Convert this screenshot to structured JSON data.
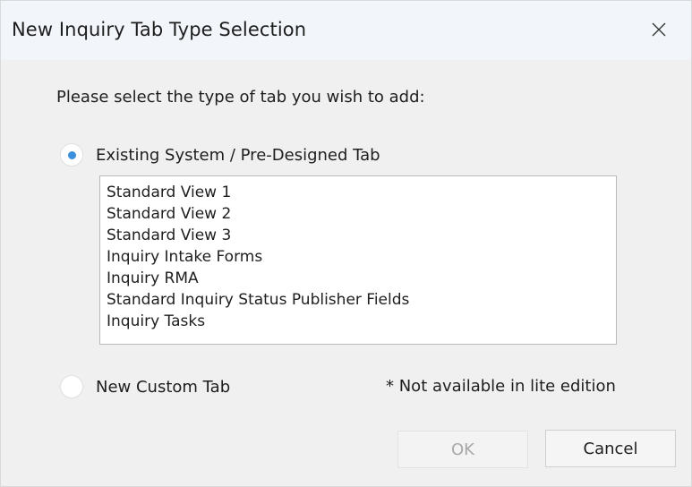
{
  "window": {
    "title": "New Inquiry Tab Type Selection",
    "close_icon": "close-icon"
  },
  "prompt": "Please select the type of tab you wish to add:",
  "options": {
    "existing": {
      "label": "Existing System / Pre-Designed Tab",
      "selected": true
    },
    "custom": {
      "label": "New Custom Tab",
      "selected": false,
      "note": "* Not available in lite edition"
    }
  },
  "tab_list": [
    "Standard View 1",
    "Standard View 2",
    "Standard View 3",
    "Inquiry Intake Forms",
    "Inquiry RMA",
    "Standard Inquiry Status Publisher Fields",
    "Inquiry Tasks"
  ],
  "buttons": {
    "ok": "OK",
    "cancel": "Cancel"
  },
  "colors": {
    "titlebar": "#f2f5fa",
    "dialog_bg": "#f0f0f0",
    "radio_accent": "#3c8fdc"
  }
}
